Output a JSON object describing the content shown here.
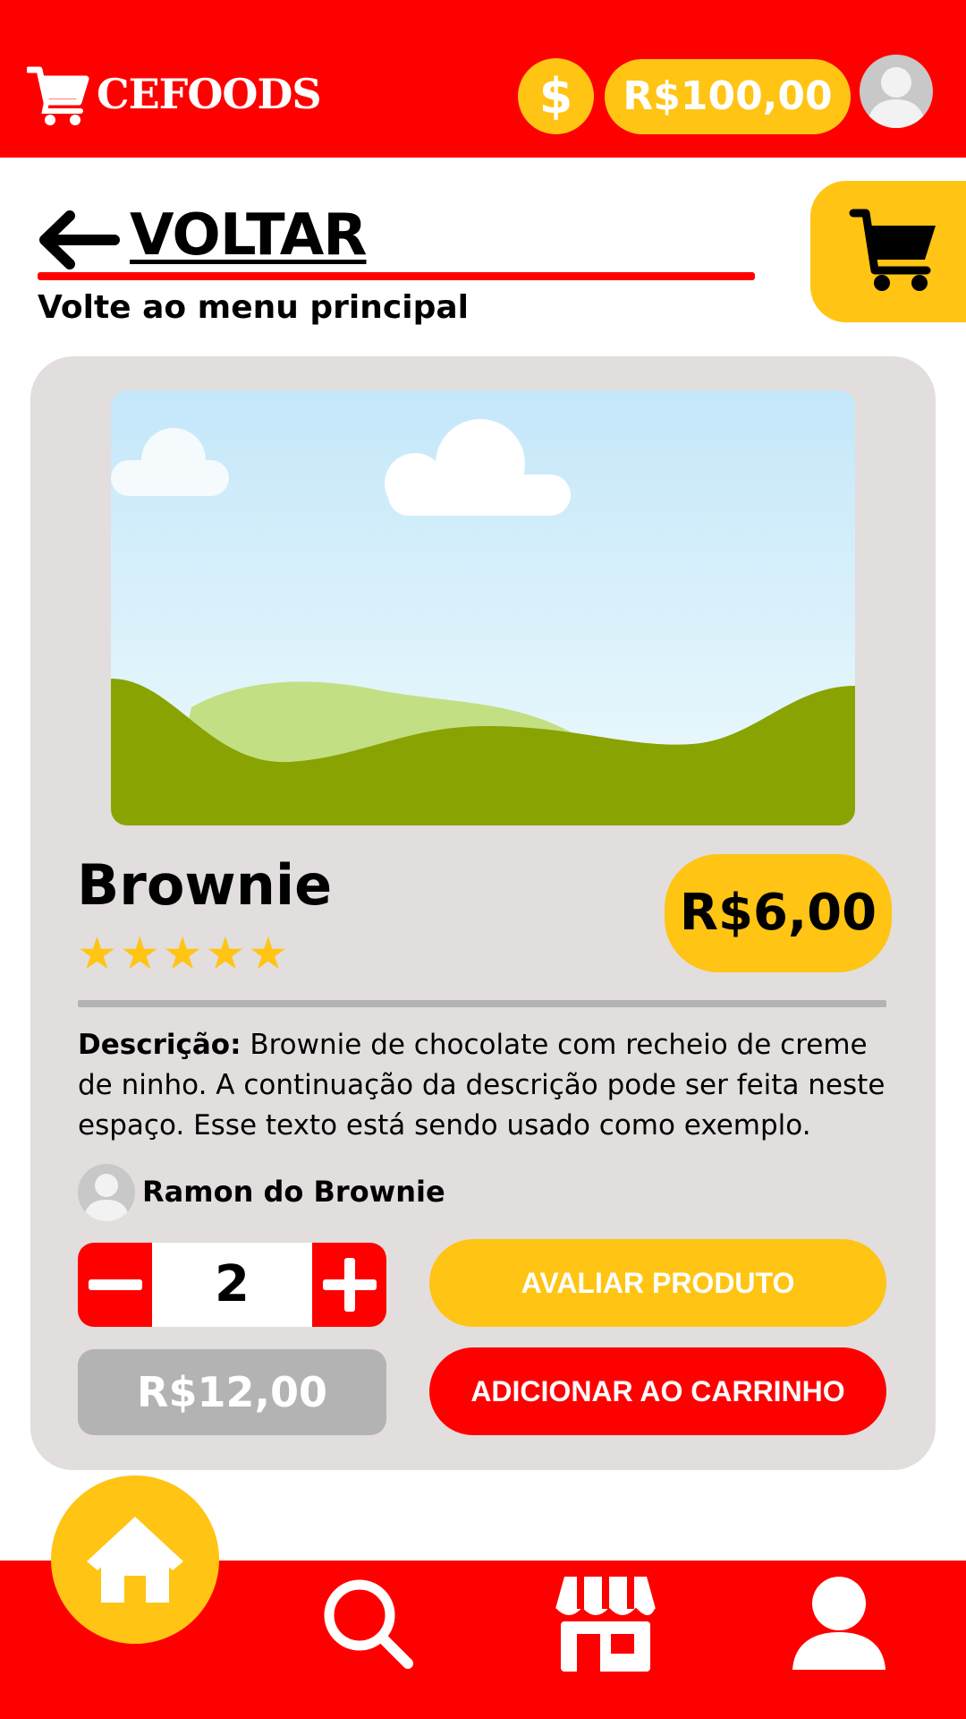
{
  "header": {
    "brand": "CEFOODS",
    "coin_symbol": "$",
    "balance": "R$100,00"
  },
  "back": {
    "label": "VOLTAR",
    "subtitle": "Volte ao menu principal"
  },
  "product": {
    "name": "Brownie",
    "rating_stars": 5,
    "price": "R$6,00",
    "description_label": "Descrição:",
    "description_text": " Brownie de chocolate com recheio de creme de ninho. A continuação da descrição pode ser feita neste espaço. Esse texto está sendo usado como exemplo.",
    "seller": "Ramon do Brownie",
    "quantity": "2",
    "total": "R$12,00"
  },
  "actions": {
    "rate": "AVALIAR PRODUTO",
    "add_to_cart": "ADICIONAR AO CARRINHO"
  },
  "nav": {
    "items": [
      "home-icon",
      "search-icon",
      "store-icon",
      "profile-icon"
    ]
  },
  "colors": {
    "primary_red": "#ff0000",
    "accent_yellow": "#ffc414",
    "card_gray": "#e1dedd",
    "muted_gray": "#b3b3b3"
  }
}
